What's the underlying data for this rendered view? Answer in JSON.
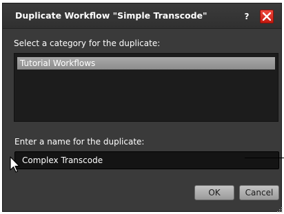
{
  "dialog": {
    "title": "Duplicate Workflow \"Simple Transcode\"",
    "help_label": "?",
    "category_label": "Select a category for the duplicate:",
    "categories": [
      "Tutorial Workflows"
    ],
    "name_label": "Enter a name for the duplicate:",
    "name_value": "Complex Transcode",
    "ok_label": "OK",
    "cancel_label": "Cancel"
  },
  "colors": {
    "dialog_bg": "#3a3a3a",
    "field_bg": "#141414",
    "selected_item": "#9a9a9a",
    "close_red": "#d9261a"
  },
  "icons": [
    "help-icon",
    "close-icon",
    "mouse-pointer-icon",
    "resize-grip-icon"
  ]
}
